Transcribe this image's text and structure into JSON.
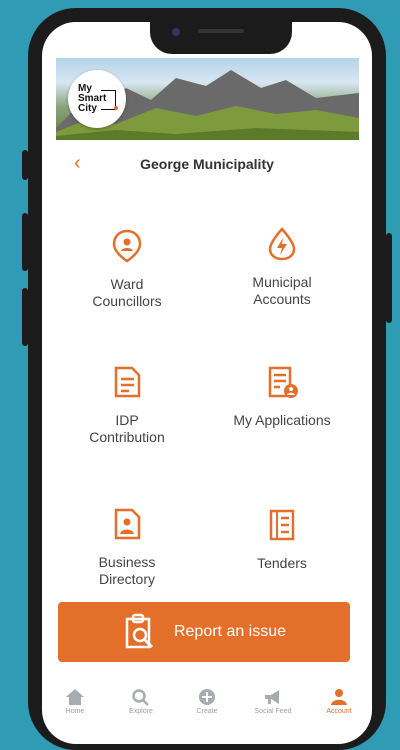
{
  "banner": {
    "logo_lines": [
      "My",
      "Smart",
      "City"
    ]
  },
  "header": {
    "back_icon": "chevron-left-icon",
    "title": "George Municipality"
  },
  "services": [
    {
      "label_lines": [
        "Ward",
        "Councillors"
      ],
      "icon": "location-pin-icon"
    },
    {
      "label_lines": [
        "Municipal",
        "Accounts"
      ],
      "icon": "energy-drop-icon"
    },
    {
      "label_lines": [
        "IDP",
        "Contribution"
      ],
      "icon": "document-icon"
    },
    {
      "label_lines": [
        "My Applications"
      ],
      "icon": "application-user-icon"
    },
    {
      "label_lines": [
        "Business",
        "Directory"
      ],
      "icon": "directory-person-icon"
    },
    {
      "label_lines": [
        "Tenders"
      ],
      "icon": "tender-document-icon"
    }
  ],
  "report_button": {
    "label": "Report an issue",
    "icon": "clipboard-search-icon"
  },
  "nav": {
    "items": [
      {
        "label": "Home",
        "icon": "home-icon"
      },
      {
        "label": "Explore",
        "icon": "search-icon"
      },
      {
        "label": "Create",
        "icon": "plus-circle-icon"
      },
      {
        "label": "Social Feed",
        "icon": "megaphone-icon"
      },
      {
        "label": "Account",
        "icon": "person-icon",
        "active": true
      }
    ]
  },
  "colors": {
    "accent": "#e36f2b",
    "background": "#2f9bb5",
    "phone_frame": "#1b1b1b"
  }
}
